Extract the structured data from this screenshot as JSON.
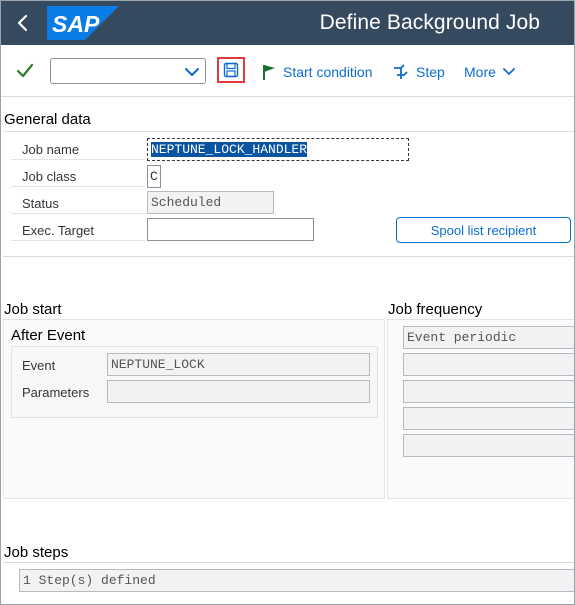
{
  "header": {
    "title": "Define Background Job",
    "logo_text": "SAP",
    "brand_color": "#0070f2",
    "bar_color": "#354a5f"
  },
  "toolbar": {
    "command_value": "",
    "start_condition_label": "Start condition",
    "step_label": "Step",
    "more_label": "More"
  },
  "general_data": {
    "title": "General data",
    "job_name_label": "Job name",
    "job_name_value": "NEPTUNE_LOCK_HANDLER",
    "job_class_label": "Job class",
    "job_class_value": "C",
    "status_label": "Status",
    "status_value": "Scheduled",
    "exec_target_label": "Exec. Target",
    "exec_target_value": "",
    "spool_button_label": "Spool list recipient"
  },
  "job_start": {
    "title": "Job start",
    "group_title": "After Event",
    "event_label": "Event",
    "event_value": "NEPTUNE_LOCK",
    "parameters_label": "Parameters",
    "parameters_value": ""
  },
  "job_frequency": {
    "title": "Job frequency",
    "rows": [
      "Event periodic",
      "",
      "",
      "",
      ""
    ]
  },
  "job_steps": {
    "title": "Job steps",
    "value": "1 Step(s) defined"
  }
}
